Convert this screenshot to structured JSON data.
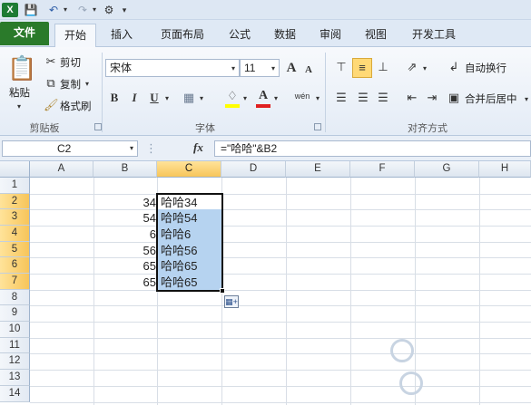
{
  "qat": {
    "save_icon": "save-icon",
    "undo_icon": "undo-icon",
    "redo_icon": "redo-icon",
    "customize_icon": "customize-icon"
  },
  "tabs": [
    {
      "label": "文件"
    },
    {
      "label": "开始"
    },
    {
      "label": "插入"
    },
    {
      "label": "页面布局"
    },
    {
      "label": "公式"
    },
    {
      "label": "数据"
    },
    {
      "label": "审阅"
    },
    {
      "label": "视图"
    },
    {
      "label": "开发工具"
    }
  ],
  "clipboard": {
    "paste": "粘贴",
    "cut": "剪切",
    "copy": "复制",
    "format_painter": "格式刷",
    "group": "剪贴板"
  },
  "font": {
    "name": "宋体",
    "size": "11",
    "bold": "B",
    "italic": "I",
    "underline": "U",
    "grow": "A",
    "shrink": "A",
    "color_letter": "A",
    "phonetic": "wén",
    "group": "字体"
  },
  "alignment": {
    "wrap": "自动换行",
    "merge": "合并后居中",
    "group": "对齐方式"
  },
  "formula_bar": {
    "name_box": "C2",
    "fx": "fx",
    "formula": "=\"哈哈\"&B2"
  },
  "columns": [
    "A",
    "B",
    "C",
    "D",
    "E",
    "F",
    "G",
    "H"
  ],
  "rows": [
    "1",
    "2",
    "3",
    "4",
    "5",
    "6",
    "7",
    "8",
    "9",
    "10",
    "11",
    "12",
    "13",
    "14"
  ],
  "cells": {
    "b2": "34",
    "b3": "54",
    "b4": "6",
    "b5": "56",
    "b6": "65",
    "b7": "65",
    "c2": "哈哈34",
    "c3": "哈哈54",
    "c4": "哈哈6",
    "c5": "哈哈56",
    "c6": "哈哈65",
    "c7": "哈哈65"
  },
  "colors": {
    "file_tab": "#2a7a2a",
    "selection_fill": "#b6d3f0",
    "header_highlight": "#f7c55a",
    "font_color_bar": "#e02020",
    "fill_color_bar": "#ffff00"
  }
}
